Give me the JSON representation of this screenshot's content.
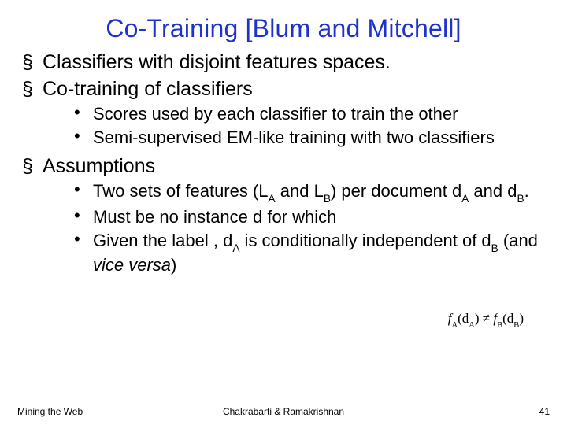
{
  "title": "Co-Training [Blum and Mitchell]",
  "bullets": {
    "a": "Classifiers with disjoint features spaces.",
    "b": "Co-training of classifiers",
    "b1": "Scores used by each classifier to train the other",
    "b2": "Semi-supervised EM-like training with two classifiers",
    "c": "Assumptions",
    "c1_pre": "Two sets of features (L",
    "c1_subA": "A",
    "c1_mid1": " and L",
    "c1_subB": "B",
    "c1_mid2": ") per document d",
    "c1_subA2": "A",
    "c1_mid3": " and d",
    "c1_subB2": "B",
    "c1_post": ".",
    "c2": "Must be no instance d for which",
    "c3_pre": "Given the label , d",
    "c3_subA": "A",
    "c3_mid1": " is conditionally independent of d",
    "c3_subB": "B",
    "c3_post1": " (and ",
    "c3_italic": "vice versa",
    "c3_post2": ")"
  },
  "formula": {
    "fA": "f",
    "subA": "A",
    "open1": "(d",
    "subA2": "A",
    "close1": ")",
    "neq": " ≠ ",
    "fB": "f",
    "subB": "B",
    "open2": "(d",
    "subB2": "B",
    "close2": ")"
  },
  "footer": {
    "left": "Mining the Web",
    "center": "Chakrabarti & Ramakrishnan",
    "right": "41"
  },
  "chart_data": {
    "type": "table",
    "title": "Co-Training [Blum and Mitchell] — slide outline",
    "rows": [
      {
        "level": 1,
        "text": "Classifiers with disjoint features spaces."
      },
      {
        "level": 1,
        "text": "Co-training of classifiers"
      },
      {
        "level": 2,
        "text": "Scores used by each classifier to train the other"
      },
      {
        "level": 2,
        "text": "Semi-supervised EM-like training with two classifiers"
      },
      {
        "level": 1,
        "text": "Assumptions"
      },
      {
        "level": 2,
        "text": "Two sets of features (L_A and L_B) per document d_A and d_B."
      },
      {
        "level": 2,
        "text": "Must be no instance d for which f_A(d_A) ≠ f_B(d_B)"
      },
      {
        "level": 2,
        "text": "Given the label , d_A is conditionally independent of d_B (and vice versa)"
      }
    ],
    "footer": {
      "left": "Mining the Web",
      "center": "Chakrabarti & Ramakrishnan",
      "page": 41
    }
  }
}
